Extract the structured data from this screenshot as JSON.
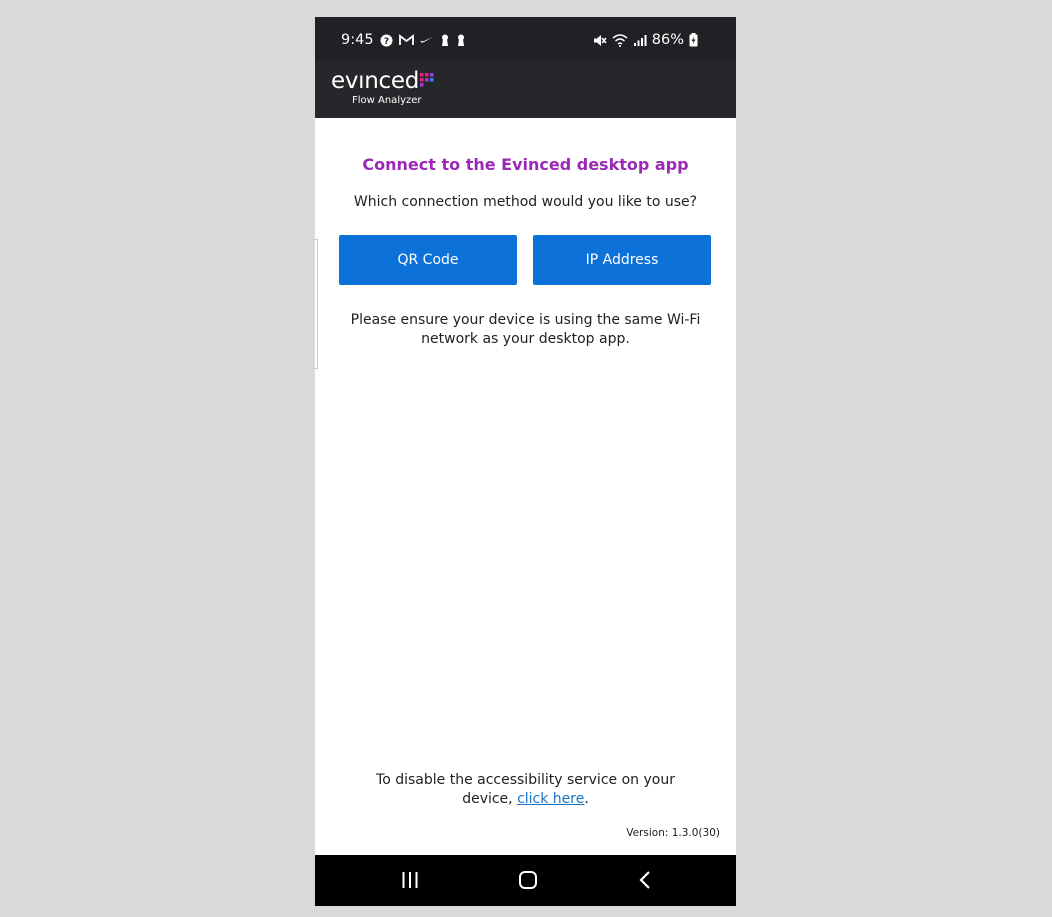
{
  "status_bar": {
    "time": "9:45",
    "battery": "86%",
    "left_icons": [
      "help-circle-icon",
      "gmail-icon",
      "nike-swoosh-icon",
      "keyhole-icon",
      "keyhole-icon"
    ],
    "right_icons": [
      "mute-icon",
      "wifi-icon",
      "signal-icon",
      "battery-charging-icon"
    ]
  },
  "header": {
    "logo_text": "evınced",
    "subtitle": "Flow Analyzer"
  },
  "main": {
    "title": "Connect to the Evinced desktop app",
    "question": "Which connection method would you like to use?",
    "buttons": {
      "qr": "QR Code",
      "ip": "IP Address"
    },
    "note": "Please ensure your device is using the same Wi-Fi network as your desktop app."
  },
  "footer": {
    "disable_prefix": "To disable the accessibility service on your device, ",
    "disable_link": "click here",
    "disable_suffix": ".",
    "version": "Version: 1.3.0(30)"
  },
  "colors": {
    "title": "#9b28b7",
    "button": "#0c71d8",
    "link": "#1a73c8",
    "header_bg": "#26272a"
  },
  "nav": {
    "icons": [
      "recent-apps-icon",
      "home-icon",
      "back-icon"
    ]
  }
}
